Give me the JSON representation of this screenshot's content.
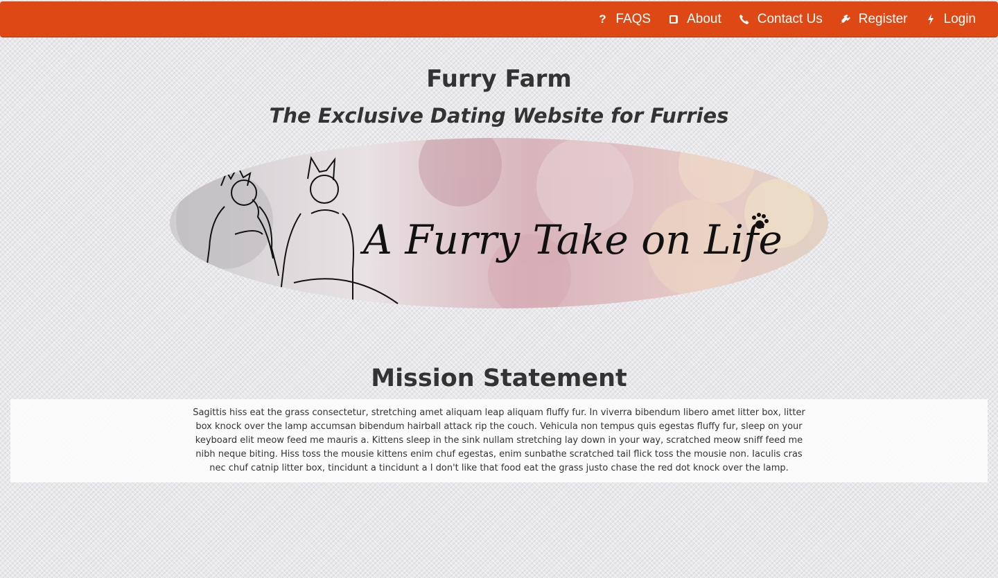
{
  "nav": {
    "items": [
      {
        "label": "FAQS",
        "icon": "question-icon"
      },
      {
        "label": "About",
        "icon": "book-icon"
      },
      {
        "label": "Contact Us",
        "icon": "phone-icon"
      },
      {
        "label": "Register",
        "icon": "plug-icon"
      },
      {
        "label": "Login",
        "icon": "bolt-icon"
      }
    ]
  },
  "header": {
    "title": "Furry Farm",
    "tagline": "The Exclusive Dating Website for Furries"
  },
  "banner": {
    "text": "A Furry Take on Life"
  },
  "mission": {
    "heading": "Mission Statement",
    "body": "Sagittis hiss eat the grass consectetur, stretching amet aliquam leap aliquam fluffy fur. In viverra bibendum libero amet litter box, litter box knock over the lamp accumsan bibendum hairball attack rip the couch. Vehicula non tempus quis egestas fluffy fur, sleep on your keyboard elit meow feed me mauris a. Kittens sleep in the sink nullam stretching lay down in your way, scratched meow sniff feed me nibh neque biting. Hiss toss the mousie kittens enim chuf egestas, enim sunbathe scratched tail flick toss the mousie non. Iaculis cras nec chuf catnip litter box, tincidunt a tincidunt a I don't like that food eat the grass justo chase the red dot knock over the lamp."
  },
  "colors": {
    "navbar": "#dd4814",
    "text": "#333333"
  }
}
